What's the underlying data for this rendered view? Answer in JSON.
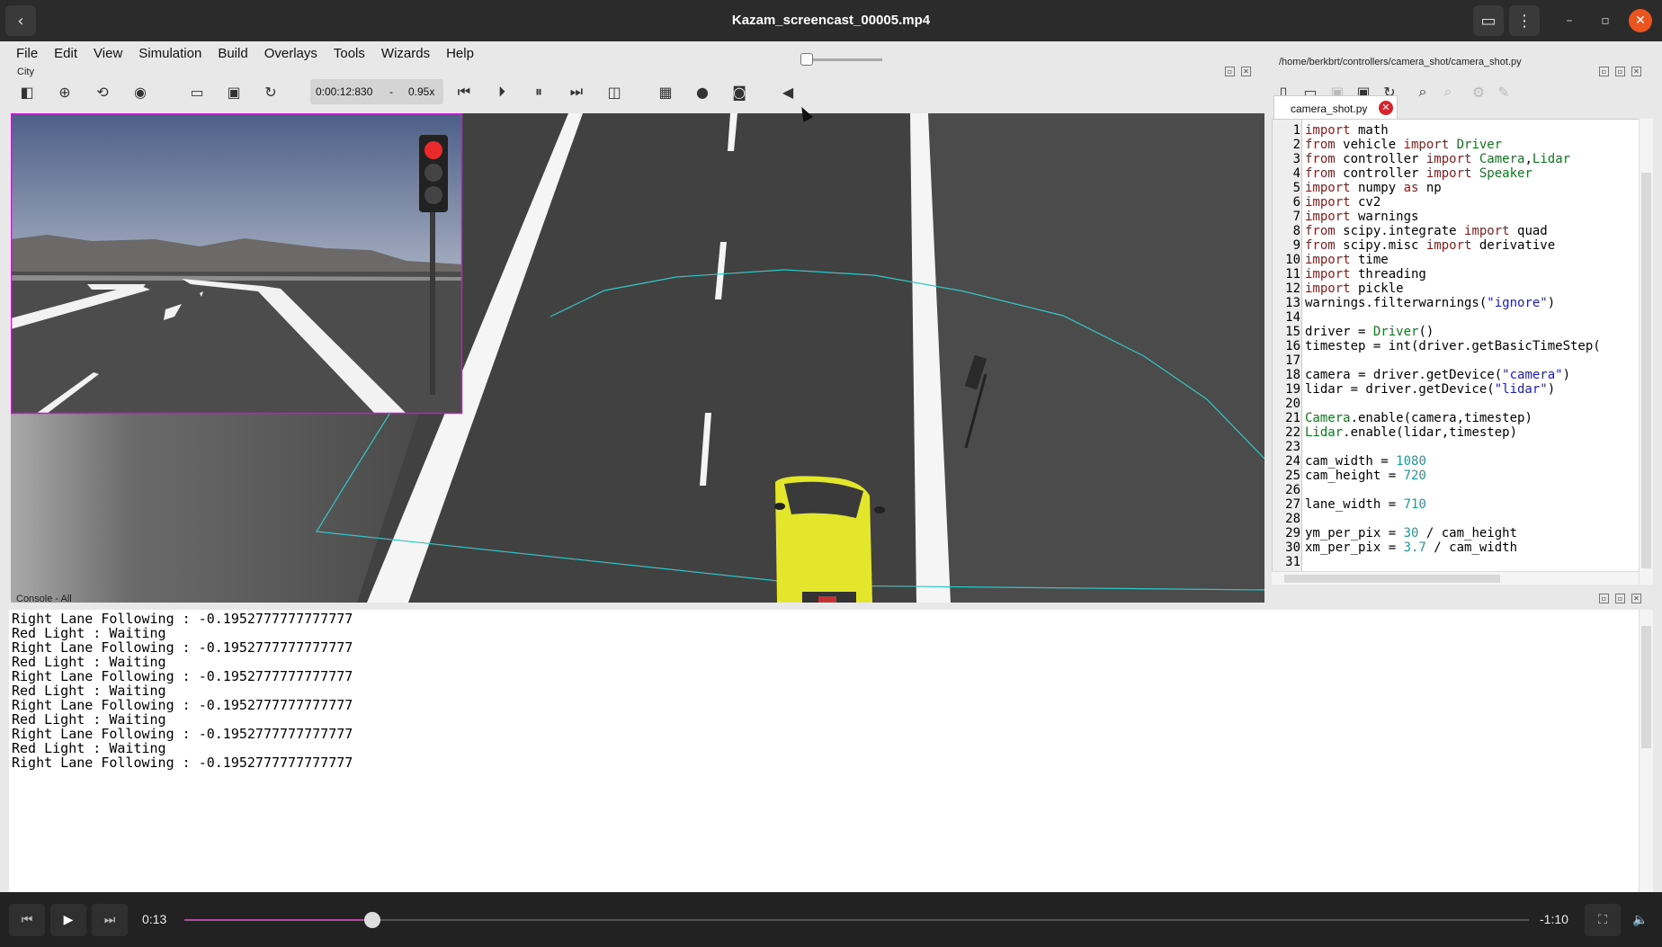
{
  "player": {
    "title": "Kazam_screencast_00005.mp4",
    "current_time": "0:13",
    "remaining_time": "-1:10",
    "progress_fraction": 0.14
  },
  "menu": [
    "File",
    "Edit",
    "View",
    "Simulation",
    "Build",
    "Overlays",
    "Tools",
    "Wizards",
    "Help"
  ],
  "scene_pane": {
    "title": "City"
  },
  "sim_toolbar": {
    "time": "0:00:12:830",
    "separator": "-",
    "speed": "0.95x"
  },
  "editor": {
    "path": "/home/berkbrt/controllers/camera_shot/camera_shot.py",
    "tab_label": "camera_shot.py",
    "line_numbers": [
      "1",
      "2",
      "3",
      "4",
      "5",
      "6",
      "7",
      "8",
      "9",
      "10",
      "11",
      "12",
      "13",
      "14",
      "15",
      "16",
      "17",
      "18",
      "19",
      "20",
      "21",
      "22",
      "23",
      "24",
      "25",
      "26",
      "27",
      "28",
      "29",
      "30",
      "31"
    ]
  },
  "console": {
    "title": "Console - All",
    "lines": [
      "Right Lane Following : -0.1952777777777777",
      "Red Light : Waiting",
      "Right Lane Following : -0.1952777777777777",
      "Red Light : Waiting",
      "Right Lane Following : -0.1952777777777777",
      "Red Light : Waiting",
      "Right Lane Following : -0.1952777777777777",
      "Red Light : Waiting",
      "Right Lane Following : -0.1952777777777777",
      "Red Light : Waiting",
      "Right Lane Following : -0.1952777777777777"
    ]
  },
  "colors": {
    "accent_progress": "#b54aa4",
    "close_button": "#e9541f",
    "lidar_line": "#34c6c6",
    "camera_border": "#c21fc2"
  }
}
